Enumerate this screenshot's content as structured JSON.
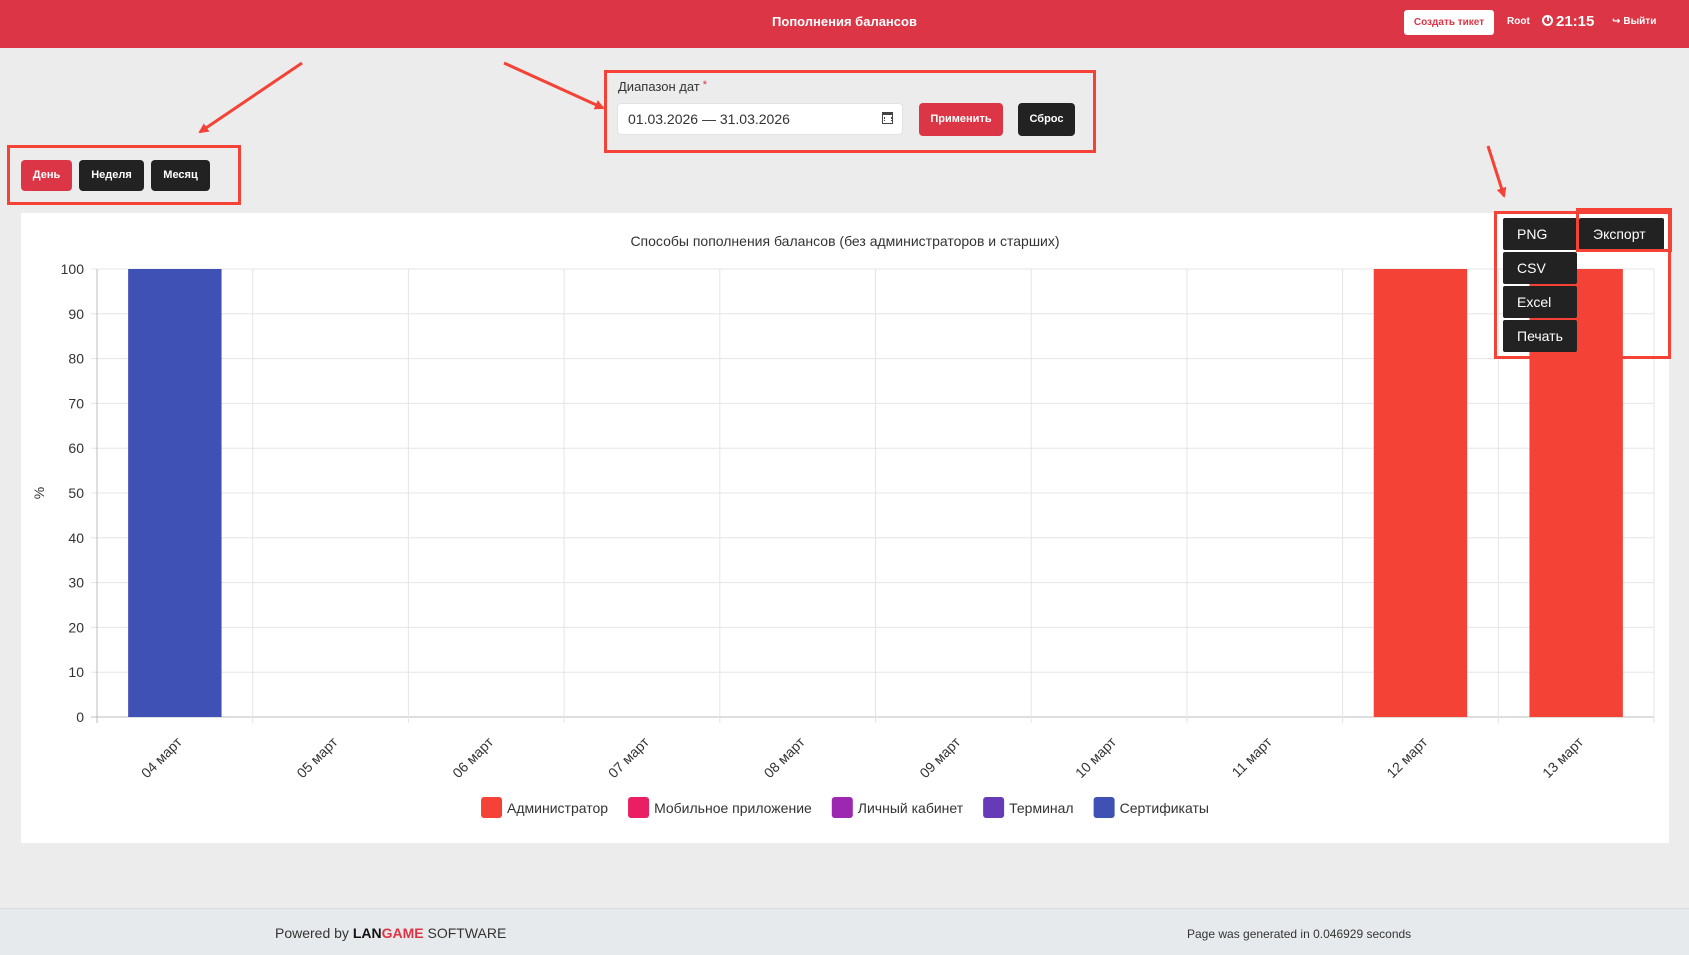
{
  "header": {
    "title": "Пополнения балансов",
    "create_ticket": "Создать тикет",
    "user": "Root",
    "time": "21:15",
    "logout": "Выйти"
  },
  "period_buttons": [
    "День",
    "Неделя",
    "Месяц"
  ],
  "date_range": {
    "label": "Диапазон дат",
    "required_mark": "*",
    "value": "01.03.2026 — 31.03.2026",
    "apply": "Применить",
    "reset": "Сброс"
  },
  "export_menu": {
    "toggle": "Экспорт",
    "items": [
      "PNG",
      "CSV",
      "Excel",
      "Печать"
    ]
  },
  "chart_data": {
    "type": "bar",
    "stacked": true,
    "title": "Способы пополнения балансов (без администраторов и старших)",
    "ylabel": "%",
    "xlabel": "",
    "ylim": [
      0,
      100
    ],
    "yticks": [
      0,
      10,
      20,
      30,
      40,
      50,
      60,
      70,
      80,
      90,
      100
    ],
    "categories": [
      "04 март",
      "05 март",
      "06 март",
      "07 март",
      "08 март",
      "09 март",
      "10 март",
      "11 март",
      "12 март",
      "13 март"
    ],
    "series": [
      {
        "name": "Администратор",
        "color": "#f44336",
        "values": [
          0,
          0,
          0,
          0,
          0,
          0,
          0,
          0,
          100,
          100
        ]
      },
      {
        "name": "Мобильное приложение",
        "color": "#e91e63",
        "values": [
          0,
          0,
          0,
          0,
          0,
          0,
          0,
          0,
          0,
          0
        ]
      },
      {
        "name": "Личный кабинет",
        "color": "#9c27b0",
        "values": [
          0,
          0,
          0,
          0,
          0,
          0,
          0,
          0,
          0,
          0
        ]
      },
      {
        "name": "Терминал",
        "color": "#673ab7",
        "values": [
          0,
          0,
          0,
          0,
          0,
          0,
          0,
          0,
          0,
          0
        ]
      },
      {
        "name": "Сертификаты",
        "color": "#3f51b5",
        "values": [
          100,
          0,
          0,
          0,
          0,
          0,
          0,
          0,
          0,
          0
        ]
      }
    ],
    "grid": true,
    "legend_position": "bottom"
  },
  "footer": {
    "powered_prefix": "Powered by",
    "brand_part1": "LAN",
    "brand_part2": "GAME",
    "brand_suffix": "SOFTWARE",
    "generated": "Page was generated in 0.046929 seconds"
  },
  "colors": {
    "accent": "#dc3545",
    "dark_button": "#222222",
    "annotation": "#f44336"
  }
}
